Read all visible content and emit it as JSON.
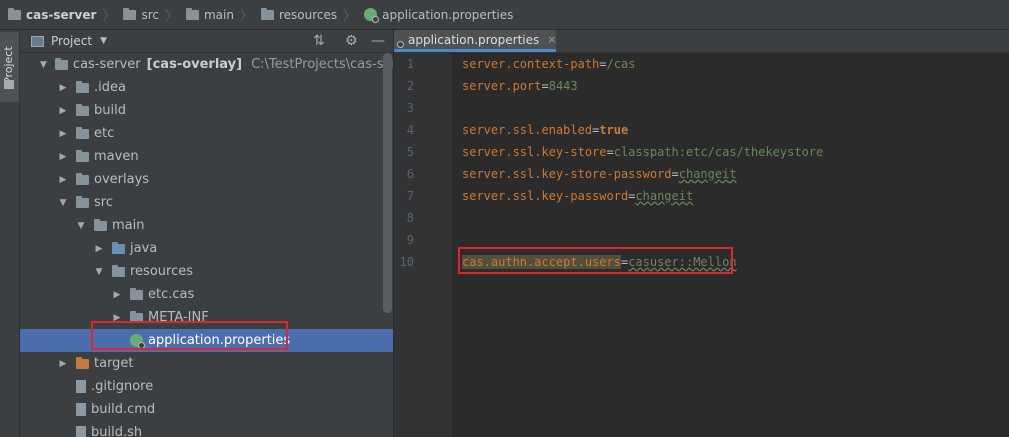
{
  "breadcrumb": [
    {
      "label": "cas-server",
      "icon": "project-folder-icon"
    },
    {
      "label": "src",
      "icon": "folder-icon"
    },
    {
      "label": "main",
      "icon": "folder-icon"
    },
    {
      "label": "resources",
      "icon": "resources-folder-icon"
    },
    {
      "label": "application.properties",
      "icon": "spring-leaf-icon"
    }
  ],
  "side_stripe": {
    "label": "Project"
  },
  "project_panel": {
    "title": "Project",
    "caret": "▼",
    "buttons": {
      "collapse": "⇅",
      "settings": "⚙",
      "hide": "—"
    }
  },
  "tree": [
    {
      "label": "cas-server",
      "module": "[cas-overlay]",
      "path": "C:\\TestProjects\\cas-server",
      "arrow": "▼",
      "icon": "project-folder-icon"
    },
    {
      "label": ".idea",
      "arrow": "▶",
      "icon": "folder-icon"
    },
    {
      "label": "build",
      "arrow": "▶",
      "icon": "folder-icon"
    },
    {
      "label": "etc",
      "arrow": "▶",
      "icon": "folder-icon"
    },
    {
      "label": "maven",
      "arrow": "▶",
      "icon": "folder-icon"
    },
    {
      "label": "overlays",
      "arrow": "▶",
      "icon": "folder-icon"
    },
    {
      "label": "src",
      "arrow": "▼",
      "icon": "folder-icon"
    },
    {
      "label": "main",
      "arrow": "▼",
      "icon": "folder-icon"
    },
    {
      "label": "java",
      "arrow": "▶",
      "icon": "source-folder-icon"
    },
    {
      "label": "resources",
      "arrow": "▼",
      "icon": "resources-folder-icon"
    },
    {
      "label": "etc.cas",
      "arrow": "▶",
      "icon": "folder-icon"
    },
    {
      "label": "META-INF",
      "arrow": "▶",
      "icon": "folder-icon"
    },
    {
      "label": "application.properties",
      "arrow": "",
      "icon": "spring-leaf-icon",
      "selected": true
    },
    {
      "label": "target",
      "arrow": "▶",
      "icon": "excluded-folder-icon"
    },
    {
      "label": ".gitignore",
      "arrow": "",
      "icon": "file-icon"
    },
    {
      "label": "build.cmd",
      "arrow": "",
      "icon": "file-icon"
    },
    {
      "label": "build.sh",
      "arrow": "",
      "icon": "file-icon"
    }
  ],
  "editor": {
    "tab_label": "application.properties",
    "tab_close": "×",
    "lines": [
      {
        "n": "1",
        "key": "server.context-path",
        "eq": "=",
        "value": "/cas"
      },
      {
        "n": "2",
        "key": "server.port",
        "eq": "=",
        "value": "8443"
      },
      {
        "n": "3",
        "key": "",
        "eq": "",
        "value": ""
      },
      {
        "n": "4",
        "key": "server.ssl.enabled",
        "eq": "=",
        "value": "true"
      },
      {
        "n": "5",
        "key": "server.ssl.key-store",
        "eq": "=",
        "value": "classpath:etc/cas/thekeystore"
      },
      {
        "n": "6",
        "key": "server.ssl.key-store-password",
        "eq": "=",
        "value": "changeit"
      },
      {
        "n": "7",
        "key": "server.ssl.key-password",
        "eq": "=",
        "value": "changeit"
      },
      {
        "n": "8",
        "key": "",
        "eq": "",
        "value": ""
      },
      {
        "n": "9",
        "key": "",
        "eq": "",
        "value": ""
      },
      {
        "n": "10",
        "key": "cas.authn.accept.users",
        "eq": "=",
        "value": "casuser::Mellon"
      }
    ]
  },
  "colors": {
    "accent": "#4b6eaf",
    "highlight_box": "#e0262b",
    "key": "#cc7832",
    "value": "#6a8759"
  }
}
